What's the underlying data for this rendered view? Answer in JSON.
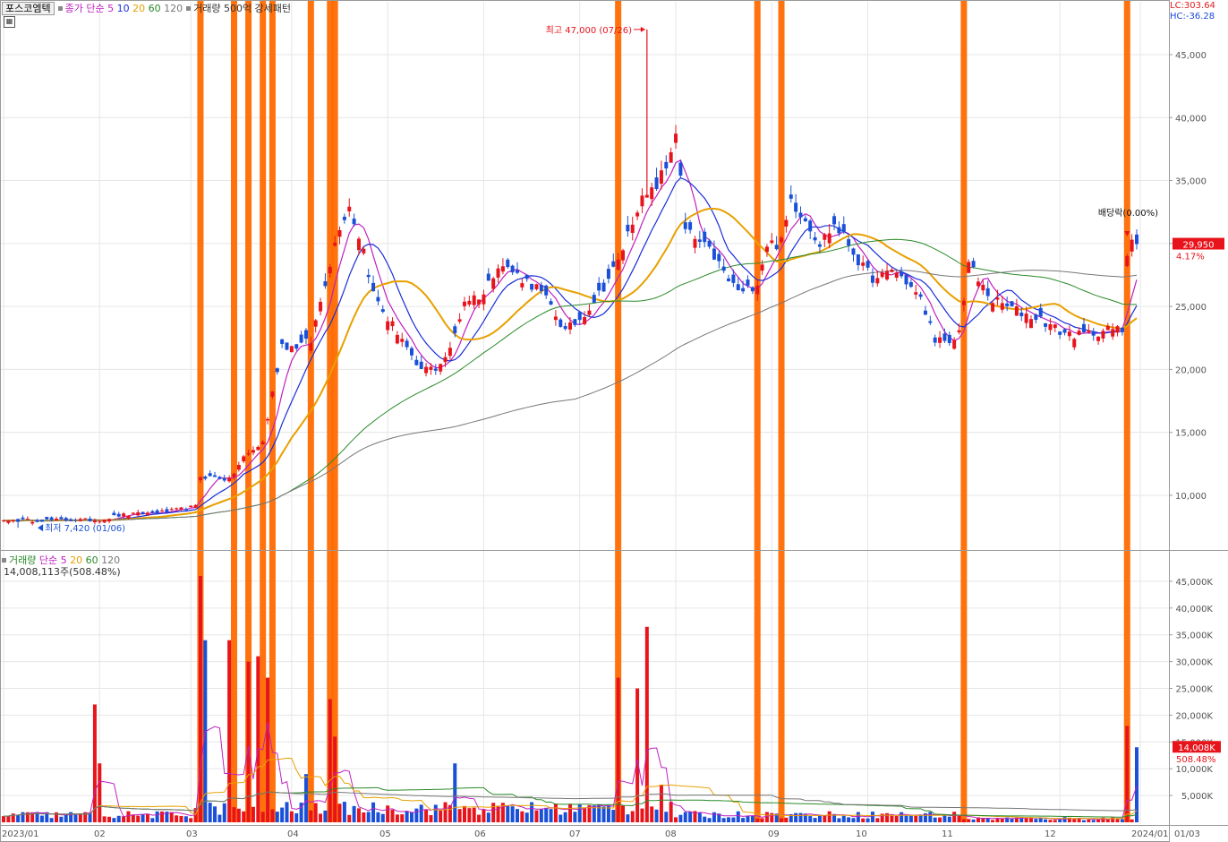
{
  "header": {
    "title": "포스코엠텍",
    "price_legend": {
      "label": "종가 단순",
      "ma": [
        "5",
        "10",
        "20",
        "60",
        "120"
      ],
      "pattern": "거래량 500억 강세패턴"
    },
    "volume_legend": {
      "label": "거래량",
      "ma_label": "단순",
      "ma": [
        "5",
        "20",
        "60",
        "120"
      ],
      "current": "14,008,113주(508.48%)"
    },
    "lc": "LC:303.64",
    "hc": "HC:-36.28"
  },
  "chart_data": {
    "type": "candlestick",
    "price_axis": {
      "ticks": [
        "45,000",
        "40,000",
        "35,000",
        "30,000",
        "25,000",
        "20,000",
        "15,000",
        "10,000"
      ],
      "ylim": [
        5800,
        48200
      ]
    },
    "volume_axis": {
      "ticks": [
        "45,000K",
        "40,000K",
        "35,000K",
        "30,000K",
        "25,000K",
        "20,000K",
        "15,000K",
        "10,000K",
        "5,000K"
      ],
      "ylim": [
        0,
        48500
      ]
    },
    "x_labels": [
      "2023/01",
      "02",
      "03",
      "04",
      "05",
      "06",
      "07",
      "08",
      "09",
      "10",
      "11",
      "12",
      "2024/01",
      "01/03"
    ],
    "annotations": {
      "high": "최고 47,000 (07/26)",
      "low": "최저 7,420 (01/06)",
      "dividend": "배당락(0.00%)"
    },
    "last_price": {
      "value": 29950,
      "label": "29,950",
      "change": "4.17%"
    },
    "last_volume": {
      "value": 14008,
      "label": "14,008K",
      "change": "508.48%"
    },
    "price_keypoints": [
      [
        0,
        8000
      ],
      [
        20,
        8050
      ],
      [
        24,
        8400
      ],
      [
        34,
        8700
      ],
      [
        40,
        9100
      ],
      [
        41,
        11500
      ],
      [
        45,
        11400
      ],
      [
        47,
        11200
      ],
      [
        50,
        13000
      ],
      [
        54,
        14200
      ],
      [
        58,
        22000
      ],
      [
        60,
        21800
      ],
      [
        64,
        22200
      ],
      [
        67,
        27000
      ],
      [
        70,
        31500
      ],
      [
        72,
        33000
      ],
      [
        75,
        29500
      ],
      [
        77,
        26000
      ],
      [
        80,
        24000
      ],
      [
        83,
        22500
      ],
      [
        86,
        20000
      ],
      [
        90,
        20100
      ],
      [
        93,
        21500
      ],
      [
        96,
        25500
      ],
      [
        100,
        26000
      ],
      [
        103,
        28500
      ],
      [
        107,
        27500
      ],
      [
        111,
        26500
      ],
      [
        114,
        25000
      ],
      [
        117,
        23000
      ],
      [
        120,
        24000
      ],
      [
        124,
        26000
      ],
      [
        128,
        28500
      ],
      [
        132,
        33000
      ],
      [
        135,
        34000
      ],
      [
        138,
        36000
      ],
      [
        140,
        39000
      ],
      [
        142,
        31000
      ],
      [
        145,
        30000
      ],
      [
        148,
        29000
      ],
      [
        151,
        27000
      ],
      [
        154,
        26000
      ],
      [
        157,
        27000
      ],
      [
        159,
        30000
      ],
      [
        162,
        30000
      ],
      [
        164,
        33500
      ],
      [
        167,
        32000
      ],
      [
        170,
        30000
      ],
      [
        173,
        31500
      ],
      [
        176,
        30000
      ],
      [
        179,
        28000
      ],
      [
        182,
        27000
      ],
      [
        185,
        28000
      ],
      [
        188,
        27000
      ],
      [
        191,
        25500
      ],
      [
        194,
        22500
      ],
      [
        197,
        21800
      ],
      [
        199,
        23000
      ],
      [
        201,
        28500
      ],
      [
        203,
        27000
      ],
      [
        206,
        25500
      ],
      [
        209,
        25000
      ],
      [
        212,
        24500
      ],
      [
        216,
        24000
      ],
      [
        220,
        23000
      ],
      [
        224,
        22700
      ],
      [
        228,
        23000
      ],
      [
        231,
        23200
      ],
      [
        233,
        23100
      ],
      [
        234,
        29000
      ],
      [
        235,
        30300
      ],
      [
        236,
        29950
      ]
    ],
    "volume_spikes": [
      [
        19,
        22000
      ],
      [
        20,
        11000
      ],
      [
        41,
        46000
      ],
      [
        42,
        34000
      ],
      [
        47,
        34000
      ],
      [
        51,
        30000
      ],
      [
        53,
        31000
      ],
      [
        55,
        27000
      ],
      [
        63,
        9000
      ],
      [
        68,
        23000
      ],
      [
        69,
        16000
      ],
      [
        94,
        11000
      ],
      [
        128,
        27000
      ],
      [
        132,
        25000
      ],
      [
        134,
        36500
      ],
      [
        137,
        7000
      ],
      [
        234,
        18000
      ],
      [
        236,
        14000
      ]
    ],
    "signal_days": [
      41,
      48,
      51,
      54,
      56,
      64,
      68,
      69,
      128,
      157,
      162,
      200,
      234
    ]
  }
}
